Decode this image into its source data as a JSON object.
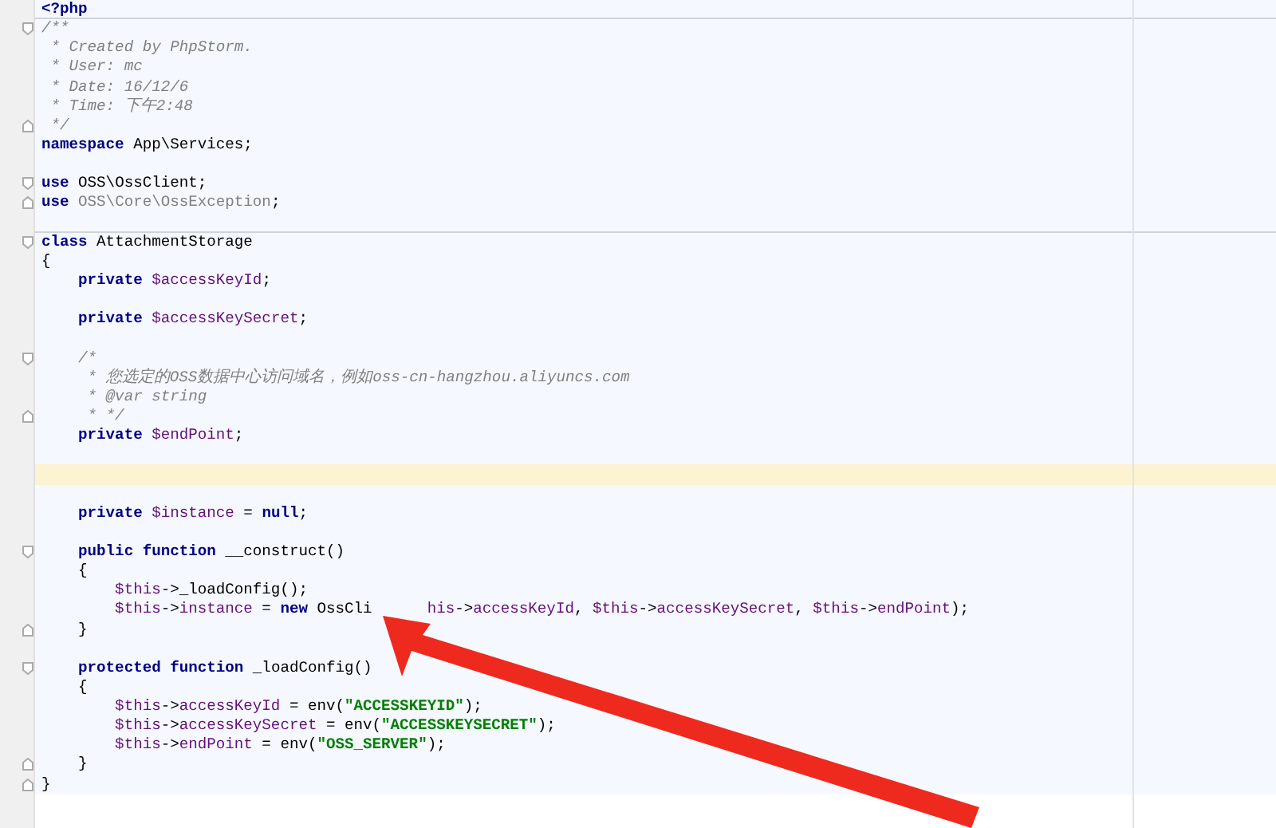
{
  "editor": {
    "lines": [
      {
        "kind": "plain",
        "separator": true,
        "current": false,
        "tokens": [
          {
            "kind": "tag",
            "text": "<?php"
          }
        ]
      },
      {
        "kind": "fold-start",
        "separator": false,
        "current": false,
        "tokens": [
          {
            "kind": "comment",
            "text": "/**"
          }
        ]
      },
      {
        "kind": "plain",
        "separator": false,
        "current": false,
        "tokens": [
          {
            "kind": "comment",
            "text": " * Created by PhpStorm."
          }
        ]
      },
      {
        "kind": "plain",
        "separator": false,
        "current": false,
        "tokens": [
          {
            "kind": "comment",
            "text": " * User: mc"
          }
        ]
      },
      {
        "kind": "plain",
        "separator": false,
        "current": false,
        "tokens": [
          {
            "kind": "comment",
            "text": " * Date: 16/12/6"
          }
        ]
      },
      {
        "kind": "plain",
        "separator": false,
        "current": false,
        "tokens": [
          {
            "kind": "comment",
            "text": " * Time: 下午2:48"
          }
        ]
      },
      {
        "kind": "fold-end",
        "separator": false,
        "current": false,
        "tokens": [
          {
            "kind": "comment",
            "text": " */"
          }
        ]
      },
      {
        "kind": "plain",
        "separator": false,
        "current": false,
        "tokens": [
          {
            "kind": "keyword",
            "text": "namespace"
          },
          {
            "kind": "plain",
            "text": " App\\Services;"
          }
        ]
      },
      {
        "kind": "plain",
        "separator": false,
        "current": false
      },
      {
        "kind": "fold-start",
        "separator": false,
        "current": false,
        "tokens": [
          {
            "kind": "keyword",
            "text": "use"
          },
          {
            "kind": "plain",
            "text": " OSS\\OssClient;"
          }
        ]
      },
      {
        "kind": "fold-end",
        "separator": false,
        "current": false,
        "tokens": [
          {
            "kind": "keyword",
            "text": "use"
          },
          {
            "kind": "unused",
            "text": " OSS\\Core\\OssException"
          },
          {
            "kind": "plain",
            "text": ";"
          }
        ]
      },
      {
        "kind": "plain",
        "separator": true,
        "current": false
      },
      {
        "kind": "fold-start",
        "separator": false,
        "current": false,
        "tokens": [
          {
            "kind": "keyword",
            "text": "class"
          },
          {
            "kind": "plain",
            "text": " AttachmentStorage"
          }
        ]
      },
      {
        "kind": "plain",
        "separator": false,
        "current": false,
        "tokens": [
          {
            "kind": "plain",
            "text": "{"
          }
        ]
      },
      {
        "kind": "plain",
        "separator": false,
        "current": false,
        "tokens": [
          {
            "kind": "keyword",
            "text": "    private"
          },
          {
            "kind": "variable",
            "text": " $accessKeyId"
          },
          {
            "kind": "plain",
            "text": ";"
          }
        ]
      },
      {
        "kind": "plain",
        "separator": false,
        "current": false
      },
      {
        "kind": "plain",
        "separator": false,
        "current": false,
        "tokens": [
          {
            "kind": "keyword",
            "text": "    private"
          },
          {
            "kind": "variable",
            "text": " $accessKeySecret"
          },
          {
            "kind": "plain",
            "text": ";"
          }
        ]
      },
      {
        "kind": "plain",
        "separator": false,
        "current": false
      },
      {
        "kind": "fold-start",
        "separator": false,
        "current": false,
        "tokens": [
          {
            "kind": "comment",
            "text": "    /*"
          }
        ]
      },
      {
        "kind": "plain",
        "separator": false,
        "current": false,
        "tokens": [
          {
            "kind": "comment",
            "text": "     * 您选定的OSS数据中心访问域名，例如oss-cn-hangzhou.aliyuncs.com"
          }
        ]
      },
      {
        "kind": "plain",
        "separator": false,
        "current": false,
        "tokens": [
          {
            "kind": "comment",
            "text": "     * @var string"
          }
        ]
      },
      {
        "kind": "fold-end",
        "separator": false,
        "current": false,
        "tokens": [
          {
            "kind": "comment",
            "text": "     * */"
          }
        ]
      },
      {
        "kind": "plain",
        "separator": false,
        "current": false,
        "tokens": [
          {
            "kind": "keyword",
            "text": "    private"
          },
          {
            "kind": "variable",
            "text": " $endPoint"
          },
          {
            "kind": "plain",
            "text": ";"
          }
        ]
      },
      {
        "kind": "plain",
        "separator": false,
        "current": false
      },
      {
        "kind": "plain",
        "separator": false,
        "current": true
      },
      {
        "kind": "plain",
        "separator": false,
        "current": false
      },
      {
        "kind": "plain",
        "separator": false,
        "current": false,
        "tokens": [
          {
            "kind": "keyword",
            "text": "    private"
          },
          {
            "kind": "variable",
            "text": " $instance"
          },
          {
            "kind": "plain",
            "text": " = "
          },
          {
            "kind": "keyword",
            "text": "null"
          },
          {
            "kind": "plain",
            "text": ";"
          }
        ]
      },
      {
        "kind": "plain",
        "separator": false,
        "current": false
      },
      {
        "kind": "fold-start",
        "separator": false,
        "current": false,
        "tokens": [
          {
            "kind": "keyword",
            "text": "    public function"
          },
          {
            "kind": "plain",
            "text": " __construct()"
          }
        ]
      },
      {
        "kind": "plain",
        "separator": false,
        "current": false,
        "tokens": [
          {
            "kind": "plain",
            "text": "    {"
          }
        ]
      },
      {
        "kind": "plain",
        "separator": false,
        "current": false,
        "tokens": [
          {
            "kind": "variable",
            "text": "        $this"
          },
          {
            "kind": "plain",
            "text": "->_loadConfig();"
          }
        ]
      },
      {
        "kind": "plain",
        "separator": false,
        "current": false,
        "tokens": [
          {
            "kind": "variable",
            "text": "        $this"
          },
          {
            "kind": "plain",
            "text": "->"
          },
          {
            "kind": "variable",
            "text": "instance"
          },
          {
            "kind": "plain",
            "text": " = "
          },
          {
            "kind": "keyword",
            "text": "new"
          },
          {
            "kind": "plain",
            "text": " OssCli"
          },
          {
            "kind": "covered"
          },
          {
            "kind": "variable",
            "text": "his"
          },
          {
            "kind": "plain",
            "text": "->"
          },
          {
            "kind": "variable",
            "text": "accessKeyId"
          },
          {
            "kind": "plain",
            "text": ", "
          },
          {
            "kind": "variable",
            "text": "$this"
          },
          {
            "kind": "plain",
            "text": "->"
          },
          {
            "kind": "variable",
            "text": "accessKeySecret"
          },
          {
            "kind": "plain",
            "text": ", "
          },
          {
            "kind": "variable",
            "text": "$this"
          },
          {
            "kind": "plain",
            "text": "->"
          },
          {
            "kind": "variable",
            "text": "endPoint"
          },
          {
            "kind": "plain",
            "text": ");"
          }
        ]
      },
      {
        "kind": "fold-end",
        "separator": false,
        "current": false,
        "tokens": [
          {
            "kind": "plain",
            "text": "    }"
          }
        ]
      },
      {
        "kind": "plain",
        "separator": false,
        "current": false
      },
      {
        "kind": "fold-start",
        "separator": false,
        "current": false,
        "tokens": [
          {
            "kind": "keyword",
            "text": "    protected function"
          },
          {
            "kind": "plain",
            "text": " _loadConfig()"
          }
        ]
      },
      {
        "kind": "plain",
        "separator": false,
        "current": false,
        "tokens": [
          {
            "kind": "plain",
            "text": "    {"
          }
        ]
      },
      {
        "kind": "plain",
        "separator": false,
        "current": false,
        "tokens": [
          {
            "kind": "variable",
            "text": "        $this"
          },
          {
            "kind": "plain",
            "text": "->"
          },
          {
            "kind": "variable",
            "text": "accessKeyId"
          },
          {
            "kind": "plain",
            "text": " = env("
          },
          {
            "kind": "string",
            "text": "\"ACCESSKEYID\""
          },
          {
            "kind": "plain",
            "text": ");"
          }
        ]
      },
      {
        "kind": "plain",
        "separator": false,
        "current": false,
        "tokens": [
          {
            "kind": "variable",
            "text": "        $this"
          },
          {
            "kind": "plain",
            "text": "->"
          },
          {
            "kind": "variable",
            "text": "accessKeySecret"
          },
          {
            "kind": "plain",
            "text": " = env("
          },
          {
            "kind": "string",
            "text": "\"ACCESSKEYSECRET\""
          },
          {
            "kind": "plain",
            "text": ");"
          }
        ]
      },
      {
        "kind": "plain",
        "separator": false,
        "current": false,
        "tokens": [
          {
            "kind": "variable",
            "text": "        $this"
          },
          {
            "kind": "plain",
            "text": "->"
          },
          {
            "kind": "variable",
            "text": "endPoint"
          },
          {
            "kind": "plain",
            "text": " = env("
          },
          {
            "kind": "string",
            "text": "\"OSS_SERVER\""
          },
          {
            "kind": "plain",
            "text": ");"
          }
        ]
      },
      {
        "kind": "fold-end",
        "separator": false,
        "current": false,
        "tokens": [
          {
            "kind": "plain",
            "text": "    }"
          }
        ]
      },
      {
        "kind": "fold-end",
        "separator": false,
        "current": false,
        "tokens": [
          {
            "kind": "plain",
            "text": "}"
          }
        ]
      }
    ]
  },
  "annotation": {
    "kind": "arrow"
  }
}
